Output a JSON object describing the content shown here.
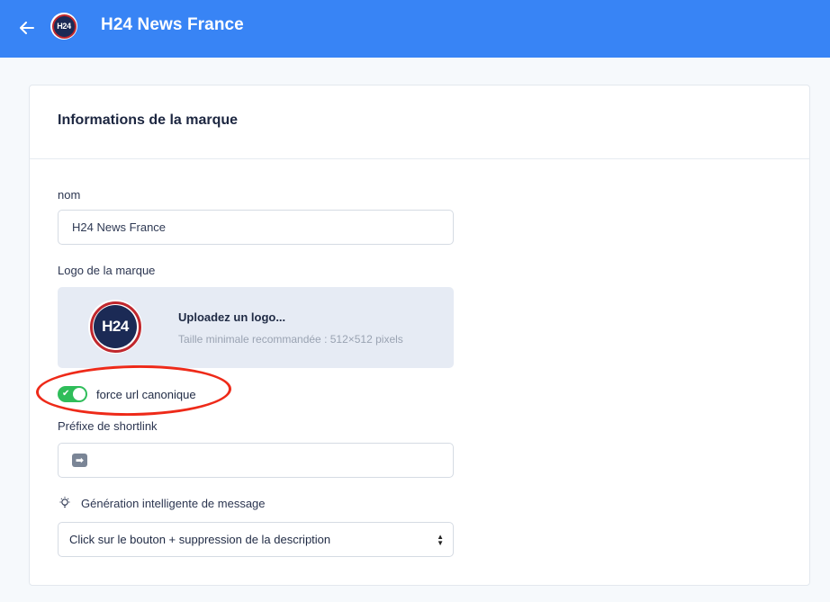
{
  "header": {
    "title": "H24 News France",
    "logo_text": "H24",
    "back_icon": "arrow-left-icon",
    "background_color": "#3884f5"
  },
  "card": {
    "title": "Informations de la marque",
    "name_field": {
      "label": "nom",
      "value": "H24 News France"
    },
    "logo_field": {
      "label": "Logo de la marque",
      "logo_text": "H24",
      "upload_title": "Uploadez un logo...",
      "upload_hint": "Taille minimale recommandée : 512×512 pixels"
    },
    "canonical_toggle": {
      "label": "force url canonique",
      "checked": true,
      "color": "#2fbd5a"
    },
    "shortlink_field": {
      "label": "Préfixe de shortlink",
      "value_icon": "right-arrow-emoji-icon"
    },
    "ai_message": {
      "label": "Génération intelligente de message",
      "icon": "lightbulb-icon",
      "selected": "Click sur le bouton + suppression de la description"
    }
  },
  "annotation": {
    "color": "#ee2a19"
  }
}
